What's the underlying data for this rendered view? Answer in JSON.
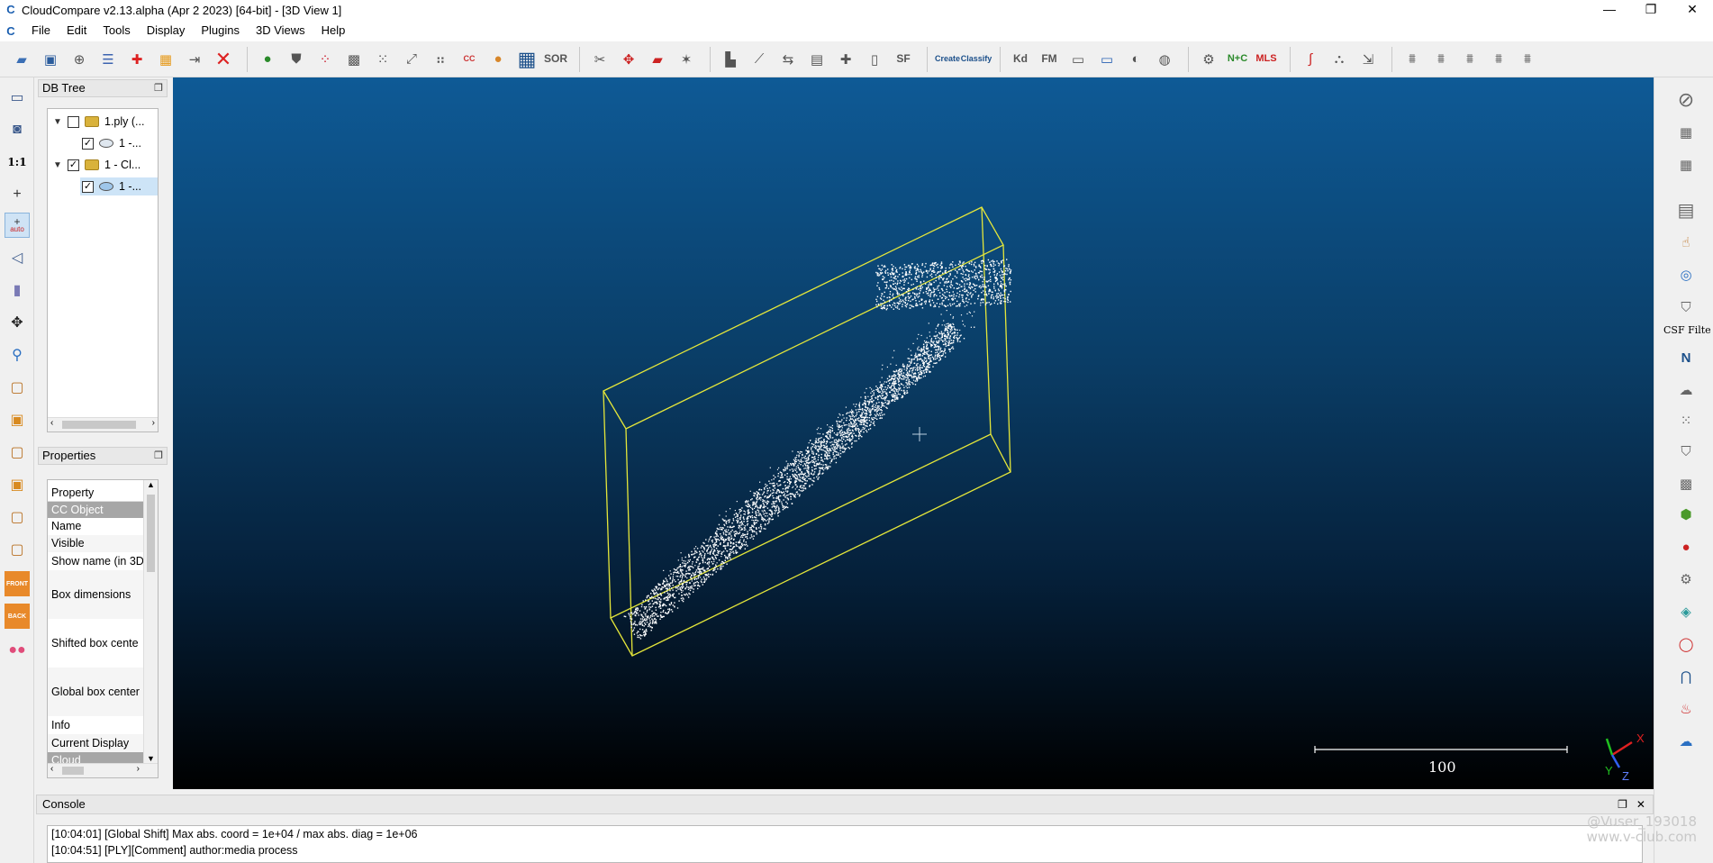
{
  "window": {
    "title": "CloudCompare v2.13.alpha (Apr  2 2023) [64-bit] - [3D View 1]",
    "controls": [
      "—",
      "❐",
      "✕"
    ]
  },
  "menu": [
    "File",
    "Edit",
    "Tools",
    "Display",
    "Plugins",
    "3D Views",
    "Help"
  ],
  "toolbar": {
    "sor_label": "SOR",
    "sf_label": "SF",
    "kd_label": "Kd",
    "fm_label": "FM",
    "nc_label": "N+C",
    "mls_label": "MLS",
    "canupo_create": "Create",
    "canupo_classify": "Classify",
    "cc_label": "CC"
  },
  "left_toolbar": {
    "zoom_label": "1:1",
    "auto_label": "auto",
    "front_label": "FRONT",
    "back_label": "BACK"
  },
  "db_tree": {
    "title": "DB Tree",
    "rows": [
      {
        "label": "1.ply (...",
        "checked": false,
        "kind": "folder"
      },
      {
        "label": "1 -...",
        "checked": true,
        "kind": "cloud"
      },
      {
        "label": "1 - Cl...",
        "checked": true,
        "kind": "folder"
      },
      {
        "label": "1 -...",
        "checked": true,
        "kind": "cloud"
      }
    ]
  },
  "properties": {
    "title": "Properties",
    "rows": [
      "Property",
      "CC Object",
      "Name",
      "Visible",
      "Show name (in 3D",
      "Box dimensions",
      "Shifted box cente",
      "Global box center",
      "Info",
      "Current Display",
      "Cloud"
    ]
  },
  "view3d": {
    "scale_label": "100",
    "axes": {
      "x": "X",
      "y": "Y",
      "z": "Z"
    }
  },
  "right_toolbar": {
    "csf_label": "CSF Filte"
  },
  "console": {
    "title": "Console",
    "lines": [
      "[10:04:01] [Global Shift] Max abs. coord = 1e+04 / max abs. diag = 1e+06",
      "[10:04:51] [PLY][Comment] author:media process"
    ]
  },
  "watermark": {
    "line1": "@Vuser_193018",
    "line2": "www.v-club.com"
  }
}
